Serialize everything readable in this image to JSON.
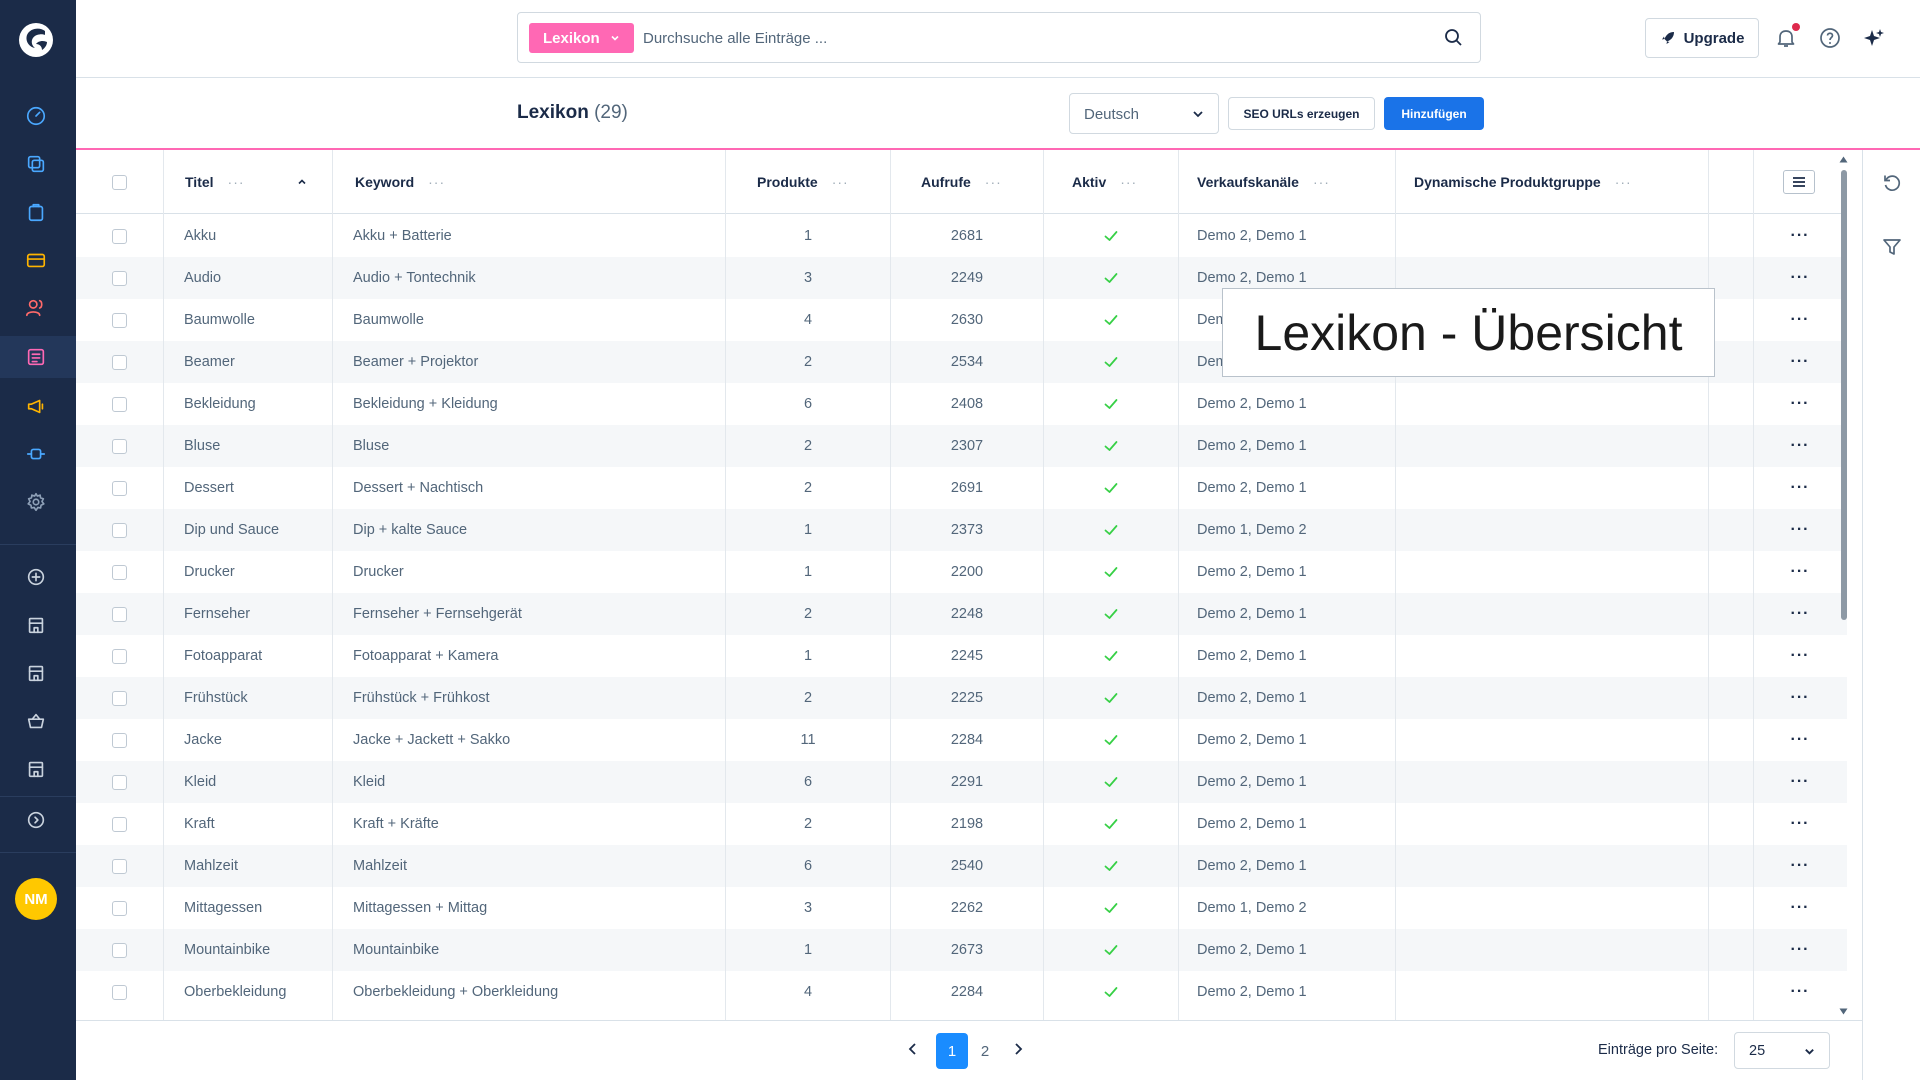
{
  "search": {
    "tag_label": "Lexikon",
    "placeholder": "Durchsuche alle Einträge ..."
  },
  "header": {
    "upgrade_label": "Upgrade"
  },
  "page": {
    "title": "Lexikon",
    "count": "(29)"
  },
  "toolbar": {
    "language": "Deutsch",
    "seo_label": "SEO URLs erzeugen",
    "add_label": "Hinzufügen"
  },
  "user": {
    "initials": "NM"
  },
  "overlay": {
    "text": "Lexikon - Übersicht"
  },
  "columns": {
    "titel": "Titel",
    "keyword": "Keyword",
    "produkte": "Produkte",
    "aufrufe": "Aufrufe",
    "aktiv": "Aktiv",
    "kanaele": "Verkaufskanäle",
    "gruppe": "Dynamische Produktgruppe"
  },
  "rows": [
    {
      "titel": "Akku",
      "keyword": "Akku + Batterie",
      "produkte": "1",
      "aufrufe": "2681",
      "kanaele": "Demo 2, Demo 1"
    },
    {
      "titel": "Audio",
      "keyword": "Audio + Tontechnik",
      "produkte": "3",
      "aufrufe": "2249",
      "kanaele": "Demo 2, Demo 1"
    },
    {
      "titel": "Baumwolle",
      "keyword": "Baumwolle",
      "produkte": "4",
      "aufrufe": "2630",
      "kanaele": "Dem"
    },
    {
      "titel": "Beamer",
      "keyword": "Beamer + Projektor",
      "produkte": "2",
      "aufrufe": "2534",
      "kanaele": "Dem"
    },
    {
      "titel": "Bekleidung",
      "keyword": "Bekleidung + Kleidung",
      "produkte": "6",
      "aufrufe": "2408",
      "kanaele": "Demo 2, Demo 1"
    },
    {
      "titel": "Bluse",
      "keyword": "Bluse",
      "produkte": "2",
      "aufrufe": "2307",
      "kanaele": "Demo 2, Demo 1"
    },
    {
      "titel": "Dessert",
      "keyword": "Dessert + Nachtisch",
      "produkte": "2",
      "aufrufe": "2691",
      "kanaele": "Demo 2, Demo 1"
    },
    {
      "titel": "Dip und Sauce",
      "keyword": "Dip + kalte Sauce",
      "produkte": "1",
      "aufrufe": "2373",
      "kanaele": "Demo 1, Demo 2"
    },
    {
      "titel": "Drucker",
      "keyword": "Drucker",
      "produkte": "1",
      "aufrufe": "2200",
      "kanaele": "Demo 2, Demo 1"
    },
    {
      "titel": "Fernseher",
      "keyword": "Fernseher + Fernsehgerät",
      "produkte": "2",
      "aufrufe": "2248",
      "kanaele": "Demo 2, Demo 1"
    },
    {
      "titel": "Fotoapparat",
      "keyword": "Fotoapparat + Kamera",
      "produkte": "1",
      "aufrufe": "2245",
      "kanaele": "Demo 2, Demo 1"
    },
    {
      "titel": "Frühstück",
      "keyword": "Frühstück + Frühkost",
      "produkte": "2",
      "aufrufe": "2225",
      "kanaele": "Demo 2, Demo 1"
    },
    {
      "titel": "Jacke",
      "keyword": "Jacke + Jackett + Sakko",
      "produkte": "11",
      "aufrufe": "2284",
      "kanaele": "Demo 2, Demo 1"
    },
    {
      "titel": "Kleid",
      "keyword": "Kleid",
      "produkte": "6",
      "aufrufe": "2291",
      "kanaele": "Demo 2, Demo 1"
    },
    {
      "titel": "Kraft",
      "keyword": "Kraft + Kräfte",
      "produkte": "2",
      "aufrufe": "2198",
      "kanaele": "Demo 2, Demo 1"
    },
    {
      "titel": "Mahlzeit",
      "keyword": "Mahlzeit",
      "produkte": "6",
      "aufrufe": "2540",
      "kanaele": "Demo 2, Demo 1"
    },
    {
      "titel": "Mittagessen",
      "keyword": "Mittagessen + Mittag",
      "produkte": "3",
      "aufrufe": "2262",
      "kanaele": "Demo 1, Demo 2"
    },
    {
      "titel": "Mountainbike",
      "keyword": "Mountainbike",
      "produkte": "1",
      "aufrufe": "2673",
      "kanaele": "Demo 2, Demo 1"
    },
    {
      "titel": "Oberbekleidung",
      "keyword": "Oberbekleidung + Oberkleidung",
      "produkte": "4",
      "aufrufe": "2284",
      "kanaele": "Demo 2, Demo 1"
    }
  ],
  "pagination": {
    "pages": [
      "1",
      "2"
    ],
    "current": "1",
    "per_page_label": "Einträge pro Seite:",
    "per_page": "25"
  },
  "colors": {
    "sidebar": "#1b2b48",
    "accent_pink": "#ff68b4",
    "primary_blue": "#1a73e8",
    "check_green": "#37d046",
    "avatar": "#ffc800"
  }
}
